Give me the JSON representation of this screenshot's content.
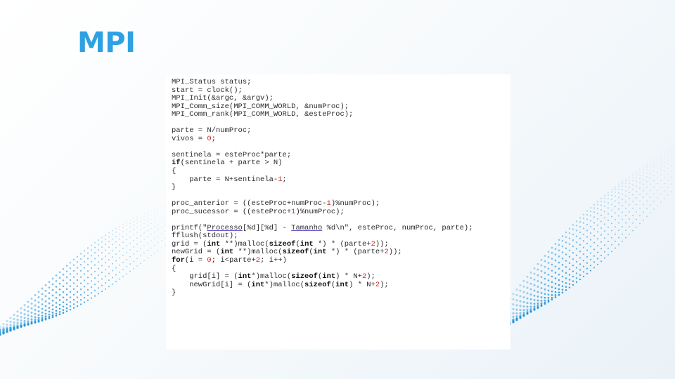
{
  "slide": {
    "title": "MPI",
    "colors": {
      "title": "#2ea1e3",
      "dots": "#1a8fd6",
      "background": "#f4f8fb"
    },
    "decoration": "dotted-wave-pattern"
  },
  "code": {
    "language": "C",
    "lines": [
      "MPI_Status status;",
      "start = clock();",
      "MPI_Init(&argc, &argv);",
      "MPI_Comm_size(MPI_COMM_WORLD, &numProc);",
      "MPI_Comm_rank(MPI_COMM_WORLD, &esteProc);",
      "",
      "parte = N/numProc;",
      "vivos = 0;",
      "",
      "sentinela = esteProc*parte;",
      "if(sentinela + parte > N)",
      "{",
      "    parte = N+sentinela-1;",
      "}",
      "",
      "proc_anterior = ((esteProc+numProc-1)%numProc);",
      "proc_sucessor = ((esteProc+1)%numProc);",
      "",
      "printf(\"Processo[%d][%d] - Tamanho %d\\n\", esteProc, numProc, parte);",
      "fflush(stdout);",
      "grid = (int **)malloc(sizeof(int *) * (parte+2));",
      "newGrid = (int **)malloc(sizeof(int *) * (parte+2));",
      "for(i = 0; i<parte+2; i++)",
      "{",
      "    grid[i] = (int*)malloc(sizeof(int) * N+2);",
      "    newGrid[i] = (int*)malloc(sizeof(int) * N+2);",
      "}"
    ]
  }
}
